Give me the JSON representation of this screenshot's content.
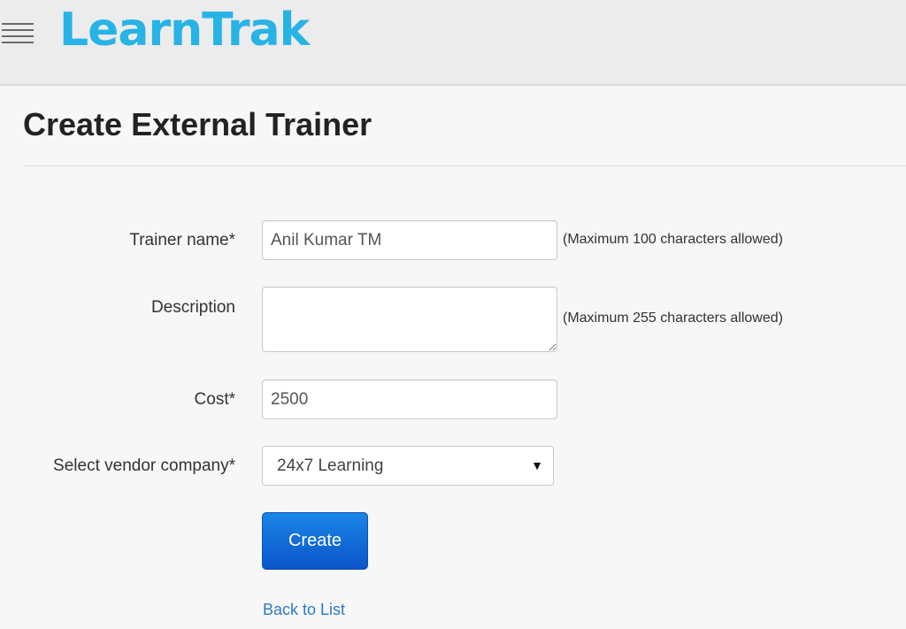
{
  "header": {
    "menu_icon": "hamburger-menu-icon",
    "logo_text": "LearnTrak",
    "brand_color": "#27b3e6"
  },
  "page": {
    "title": "Create External Trainer"
  },
  "form": {
    "trainer_name": {
      "label": "Trainer name*",
      "value": "Anil Kumar TM",
      "hint": "(Maximum 100 characters allowed)"
    },
    "description": {
      "label": "Description",
      "value": "",
      "hint": "(Maximum 255 characters allowed)"
    },
    "cost": {
      "label": "Cost*",
      "value": "2500"
    },
    "vendor": {
      "label": "Select vendor company*",
      "selected": "24x7 Learning",
      "arrow_icon": "dropdown-arrow-icon"
    },
    "create_label": "Create",
    "back_link": "Back to List"
  },
  "colors": {
    "button": "#0b55c8",
    "link": "#2a7bc4"
  }
}
